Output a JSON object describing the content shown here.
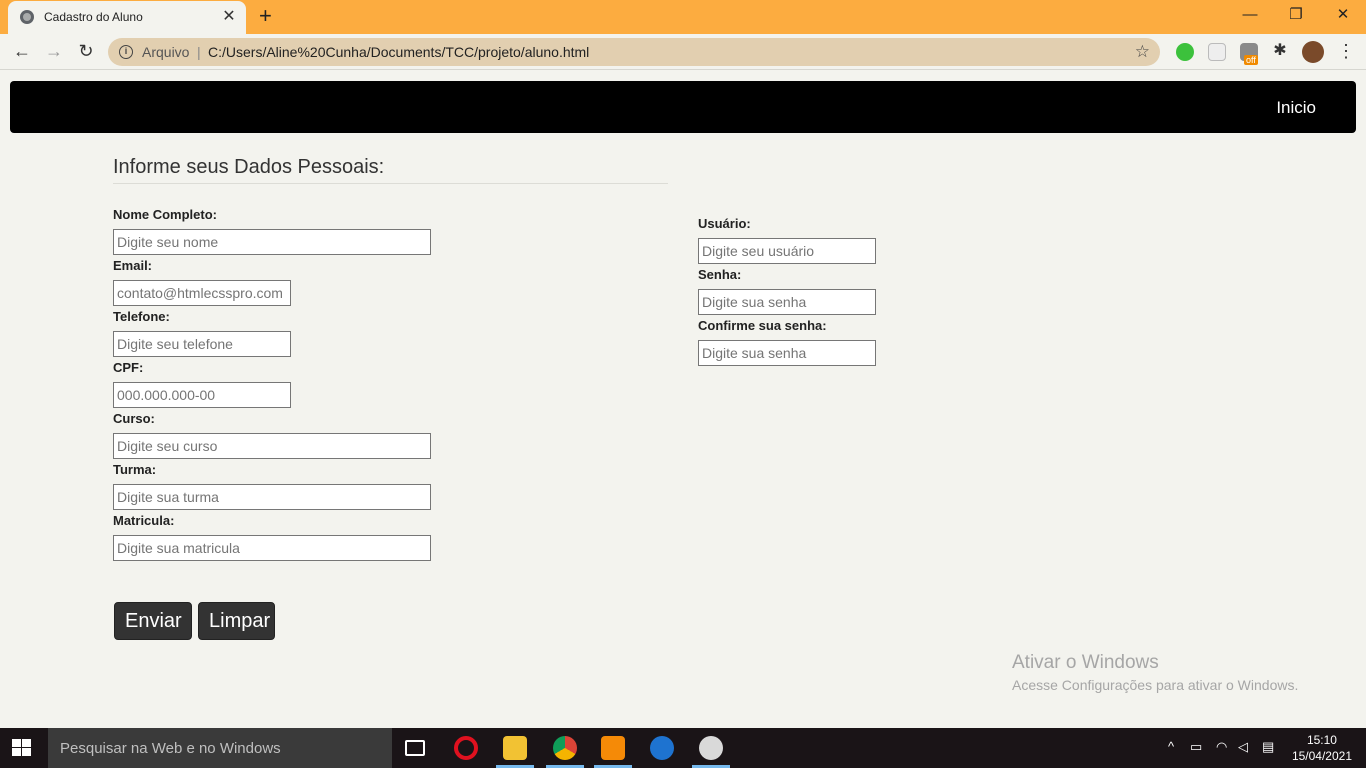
{
  "browser": {
    "tab_title": "Cadastro do Aluno",
    "scheme_label": "Arquivo",
    "url": "C:/Users/Aline%20Cunha/Documents/TCC/projeto/aluno.html",
    "ext_badge": "off"
  },
  "nav": {
    "home_link": "Inicio"
  },
  "form": {
    "title": "Informe seus Dados Pessoais:",
    "left_fields": [
      {
        "label": "Nome Completo:",
        "placeholder": "Digite seu nome"
      },
      {
        "label": "Email:",
        "placeholder": "contato@htmlecsspro.com"
      },
      {
        "label": "Telefone:",
        "placeholder": "Digite seu telefone"
      },
      {
        "label": "CPF:",
        "placeholder": "000.000.000-00"
      },
      {
        "label": "Curso:",
        "placeholder": "Digite seu curso"
      },
      {
        "label": "Turma:",
        "placeholder": "Digite sua turma"
      },
      {
        "label": "Matricula:",
        "placeholder": "Digite sua matricula"
      }
    ],
    "right_fields": [
      {
        "label": "Usuário:",
        "placeholder": "Digite seu usuário"
      },
      {
        "label": "Senha:",
        "placeholder": "Digite sua senha"
      },
      {
        "label": "Confirme sua senha:",
        "placeholder": "Digite sua senha"
      }
    ],
    "submit_label": "Enviar",
    "reset_label": "Limpar"
  },
  "watermark": {
    "line1": "Ativar o Windows",
    "line2": "Acesse Configurações para ativar o Windows."
  },
  "taskbar": {
    "search_placeholder": "Pesquisar na Web e no Windows",
    "time": "15:10",
    "date": "15/04/2021"
  },
  "colors": {
    "tab_strip": "#fcac40",
    "page_bg": "#f3f3ee",
    "nav_bg": "#000000",
    "button_bg": "#333333"
  }
}
